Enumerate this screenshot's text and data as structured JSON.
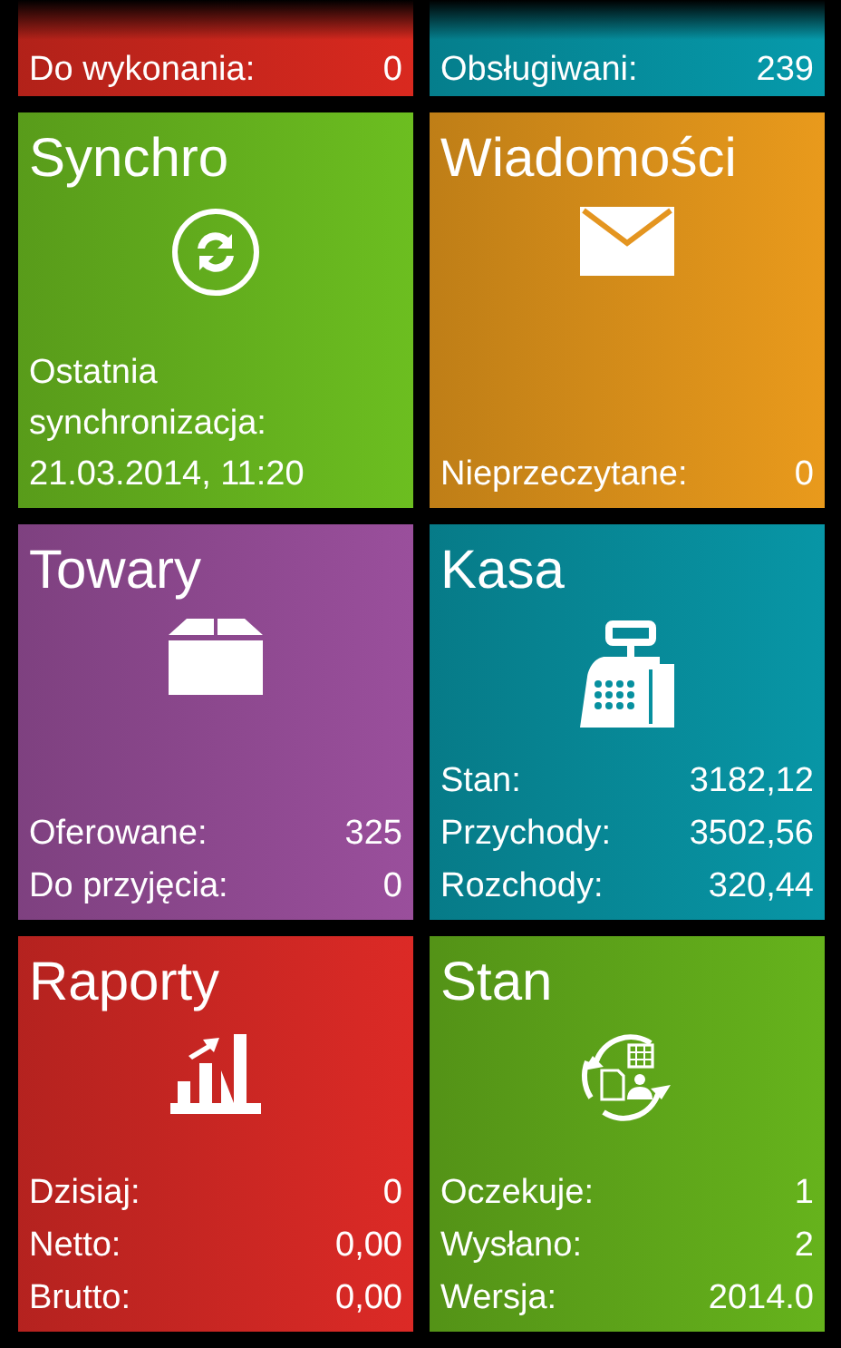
{
  "summary": [
    {
      "label": "Do wykonania:",
      "value": "0",
      "color": "#d9291f"
    },
    {
      "label": "Obsługiwani:",
      "value": "239",
      "color": "#069aab"
    }
  ],
  "tiles": [
    {
      "title": "Synchro",
      "kind": "sync",
      "color": "#6cbe20",
      "rows": [
        {
          "kind": "stacked",
          "label": "Ostatnia synchronizacja:",
          "value": "21.03.2014, 11:20"
        }
      ]
    },
    {
      "title": "Wiadomości",
      "kind": "mail",
      "color": "#e99a1c",
      "rows": [
        {
          "kind": "pair",
          "label": "Nieprzeczytane:",
          "value": "0"
        }
      ]
    },
    {
      "title": "Towary",
      "kind": "box",
      "color": "#9a4f9c",
      "rows": [
        {
          "kind": "pair",
          "label": "Oferowane:",
          "value": "325"
        },
        {
          "kind": "pair",
          "label": "Do przyjęcia:",
          "value": "0"
        }
      ]
    },
    {
      "title": "Kasa",
      "kind": "register",
      "color": "#0896a6",
      "rows": [
        {
          "kind": "pair",
          "label": "Stan:",
          "value": "3182,12"
        },
        {
          "kind": "pair",
          "label": "Przychody:",
          "value": "3502,56"
        },
        {
          "kind": "pair",
          "label": "Rozchody:",
          "value": "320,44"
        }
      ]
    },
    {
      "title": "Raporty",
      "kind": "chart",
      "color": "#dc2a26",
      "rows": [
        {
          "kind": "pair",
          "label": "Dzisiaj:",
          "value": "0"
        },
        {
          "kind": "pair",
          "label": "Netto:",
          "value": "0,00"
        },
        {
          "kind": "pair",
          "label": "Brutto:",
          "value": "0,00"
        }
      ]
    },
    {
      "title": "Stan",
      "kind": "cycle",
      "color": "#66b31c",
      "rows": [
        {
          "kind": "pair",
          "label": "Oczekuje:",
          "value": "1"
        },
        {
          "kind": "pair",
          "label": "Wysłano:",
          "value": "2"
        },
        {
          "kind": "pair",
          "label": "Wersja:",
          "value": "2014.0"
        }
      ]
    }
  ]
}
